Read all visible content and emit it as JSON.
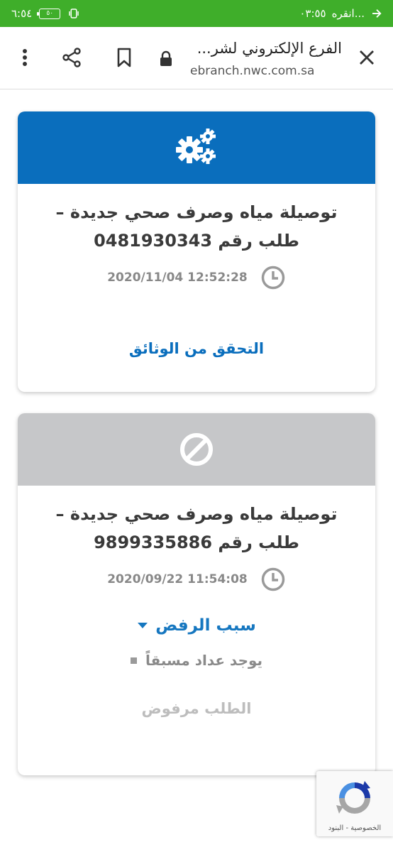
{
  "status_bar": {
    "time": "٦:٥٤",
    "battery": "٥٠",
    "notification_text": "انقره...",
    "notification_time": "٠٣:٥٥",
    "bg_color": "#3fae2a"
  },
  "browser": {
    "page_title": "الفرع الإلكتروني لشر...",
    "domain": "ebranch.nwc.com.sa",
    "icons": [
      "close-icon",
      "lock-icon",
      "bookmark-icon",
      "share-icon",
      "more-vert-icon"
    ]
  },
  "requests": [
    {
      "title_line1": "توصيلة مياه وصرف صحي جديدة –",
      "title_line2": "طلب رقم 0481930343",
      "datetime": "2020/11/04 12:52:28",
      "status_icon": "gears-icon",
      "header_color": "#0a6ebd",
      "action_label": "التحقق من الوثائق"
    },
    {
      "title_line1": "توصيلة مياه وصرف صحي جديدة –",
      "title_line2": "طلب رقم 9899335886",
      "datetime": "2020/09/22 11:54:08",
      "status_icon": "blocked-icon",
      "header_color": "#c6c7c9",
      "reason_label": "سبب الرفض",
      "reason_item": "يوجد عداد مسبقاً",
      "status_label": "الطلب مرفوض"
    }
  ],
  "recaptcha": {
    "links": "الخصوصية - البنود"
  }
}
